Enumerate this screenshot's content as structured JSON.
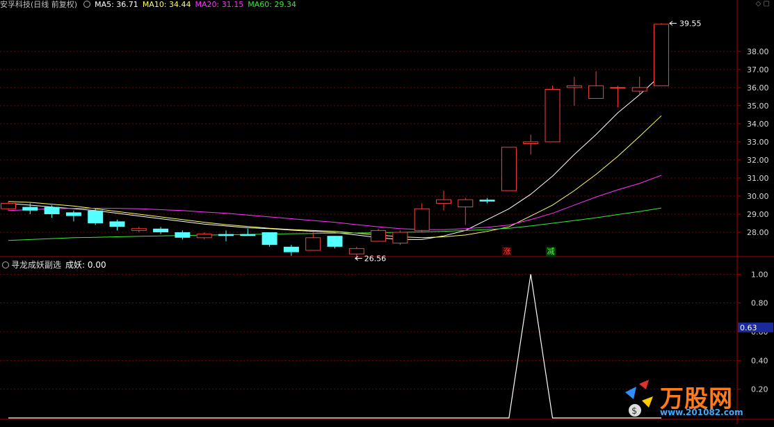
{
  "header": {
    "stock": "安孚科技(日线 前复权)",
    "ma5_label": "MA5: 36.71",
    "ma10_label": "MA10: 34.44",
    "ma20_label": "MA20: 31.15",
    "ma60_label": "MA60: 29.34",
    "colors": {
      "ma5": "#ffffff",
      "ma10": "#ffff66",
      "ma20": "#ff33ff",
      "ma60": "#33ee33"
    }
  },
  "indicator": {
    "title": "寻龙成妖副选",
    "value_label": "成妖: 0.00",
    "current_badge": "0.63"
  },
  "annotations": {
    "high": "39.55",
    "low": "26.56",
    "tag_zhang": "涨",
    "tag_jian": "减"
  },
  "logo": {
    "text": "万股网",
    "url": "www.201082.com"
  },
  "chart_data": [
    {
      "type": "candlestick",
      "title": "安孚科技(日线 前复权)",
      "ylim": [
        27.0,
        40.3
      ],
      "y_ticks": [
        28.0,
        29.0,
        30.0,
        31.0,
        32.0,
        33.0,
        34.0,
        35.0,
        36.0,
        37.0,
        38.0
      ],
      "up_color": "#ff3c3c",
      "down_color": "#54ffff",
      "candles": [
        {
          "o": 29.3,
          "c": 29.6,
          "h": 29.7,
          "l": 29.2
        },
        {
          "o": 29.4,
          "c": 29.2,
          "h": 29.6,
          "l": 29.0
        },
        {
          "o": 29.4,
          "c": 29.0,
          "h": 29.5,
          "l": 28.8
        },
        {
          "o": 29.1,
          "c": 28.9,
          "h": 29.2,
          "l": 28.6
        },
        {
          "o": 29.2,
          "c": 28.5,
          "h": 29.3,
          "l": 28.4
        },
        {
          "o": 28.6,
          "c": 28.3,
          "h": 28.7,
          "l": 28.1
        },
        {
          "o": 28.1,
          "c": 28.2,
          "h": 28.3,
          "l": 28.0
        },
        {
          "o": 28.2,
          "c": 28.0,
          "h": 28.3,
          "l": 27.9
        },
        {
          "o": 28.0,
          "c": 27.7,
          "h": 28.1,
          "l": 27.6
        },
        {
          "o": 27.7,
          "c": 27.9,
          "h": 28.0,
          "l": 27.6
        },
        {
          "o": 27.9,
          "c": 27.8,
          "h": 28.1,
          "l": 27.5
        },
        {
          "o": 27.9,
          "c": 27.8,
          "h": 28.2,
          "l": 27.8
        },
        {
          "o": 28.0,
          "c": 27.3,
          "h": 28.0,
          "l": 27.2
        },
        {
          "o": 27.2,
          "c": 26.9,
          "h": 27.3,
          "l": 26.7
        },
        {
          "o": 27.0,
          "c": 27.7,
          "h": 28.0,
          "l": 27.0
        },
        {
          "o": 27.8,
          "c": 27.2,
          "h": 27.8,
          "l": 27.1
        },
        {
          "o": 26.8,
          "c": 27.1,
          "h": 27.2,
          "l": 26.6
        },
        {
          "o": 27.5,
          "c": 28.1,
          "h": 28.2,
          "l": 27.5
        },
        {
          "o": 27.4,
          "c": 28.0,
          "h": 28.1,
          "l": 27.3
        },
        {
          "o": 28.1,
          "c": 29.3,
          "h": 29.6,
          "l": 28.0
        },
        {
          "o": 29.6,
          "c": 29.8,
          "h": 30.3,
          "l": 29.2
        },
        {
          "o": 29.4,
          "c": 29.8,
          "h": 29.9,
          "l": 28.4
        },
        {
          "o": 29.8,
          "c": 29.7,
          "h": 29.9,
          "l": 29.6
        },
        {
          "o": 30.3,
          "c": 32.7,
          "h": 32.7,
          "l": 30.3
        },
        {
          "o": 32.9,
          "c": 33.0,
          "h": 33.4,
          "l": 32.3
        },
        {
          "o": 33.0,
          "c": 35.9,
          "h": 36.1,
          "l": 33.0
        },
        {
          "o": 36.0,
          "c": 36.1,
          "h": 36.6,
          "l": 35.0
        },
        {
          "o": 35.4,
          "c": 36.1,
          "h": 36.9,
          "l": 35.4
        },
        {
          "o": 36.0,
          "c": 36.0,
          "h": 36.1,
          "l": 34.9
        },
        {
          "o": 35.8,
          "c": 36.0,
          "h": 36.6,
          "l": 35.6
        },
        {
          "o": 36.1,
          "c": 39.5,
          "h": 39.55,
          "l": 36.1
        }
      ],
      "series": [
        {
          "name": "MA5",
          "color": "#ffffff",
          "values": [
            29.6,
            29.5,
            29.4,
            29.3,
            29.2,
            29.05,
            28.9,
            28.75,
            28.6,
            28.45,
            28.35,
            28.25,
            28.2,
            28.12,
            28.05,
            27.98,
            27.85,
            27.7,
            27.6,
            27.6,
            27.8,
            28.1,
            28.7,
            29.3,
            30.1,
            31.1,
            32.3,
            33.4,
            34.6,
            35.6,
            36.71
          ]
        },
        {
          "name": "MA10",
          "color": "#ffff66",
          "values": [
            29.7,
            29.65,
            29.55,
            29.45,
            29.3,
            29.15,
            29.0,
            28.85,
            28.7,
            28.55,
            28.42,
            28.32,
            28.22,
            28.15,
            28.1,
            28.05,
            27.95,
            27.85,
            27.75,
            27.7,
            27.75,
            27.85,
            28.05,
            28.3,
            28.9,
            29.5,
            30.3,
            31.2,
            32.2,
            33.3,
            34.44
          ]
        },
        {
          "name": "MA20",
          "color": "#ff33ff",
          "values": [
            29.2,
            29.25,
            29.3,
            29.32,
            29.33,
            29.32,
            29.3,
            29.25,
            29.2,
            29.12,
            29.05,
            28.95,
            28.85,
            28.75,
            28.65,
            28.55,
            28.42,
            28.3,
            28.2,
            28.15,
            28.15,
            28.2,
            28.28,
            28.4,
            28.7,
            29.05,
            29.5,
            29.95,
            30.35,
            30.7,
            31.15
          ]
        },
        {
          "name": "MA60",
          "color": "#33ee33",
          "values": [
            27.55,
            27.6,
            27.65,
            27.7,
            27.72,
            27.75,
            27.78,
            27.8,
            27.82,
            27.84,
            27.86,
            27.88,
            27.9,
            27.92,
            27.93,
            27.95,
            27.96,
            27.98,
            28.0,
            28.02,
            28.05,
            28.1,
            28.15,
            28.22,
            28.35,
            28.5,
            28.65,
            28.8,
            28.98,
            29.15,
            29.34
          ]
        }
      ]
    },
    {
      "type": "line",
      "title": "寻龙成妖副选",
      "ylim": [
        0,
        1.05
      ],
      "y_ticks": [
        0.2,
        0.4,
        0.6,
        0.8,
        1.0
      ],
      "series": [
        {
          "name": "成妖",
          "color": "#ffffff",
          "values": [
            0,
            0,
            0,
            0,
            0,
            0,
            0,
            0,
            0,
            0,
            0,
            0,
            0,
            0,
            0,
            0,
            0,
            0,
            0,
            0,
            0,
            0,
            0,
            0,
            1,
            0,
            0,
            0,
            0,
            0,
            0
          ]
        }
      ]
    }
  ]
}
